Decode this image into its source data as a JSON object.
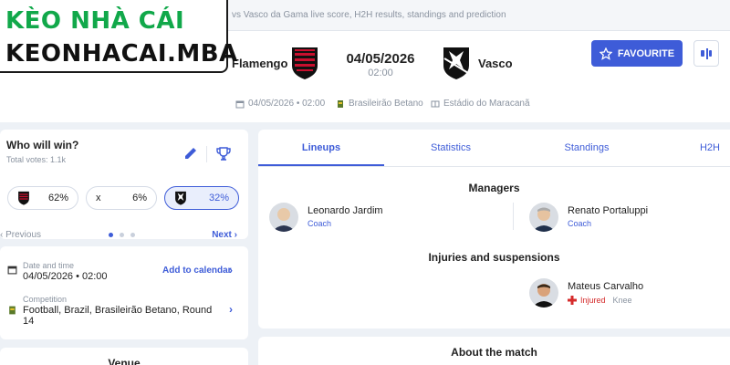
{
  "breadcrumb": "vs Vasco da Gama live score, H2H results, standings and prediction",
  "match": {
    "home_team": "Flamengo",
    "away_team": "Vasco",
    "date": "04/05/2026",
    "time": "02:00",
    "meta": {
      "datetime": "04/05/2026 • 02:00",
      "competition": "Brasileirão Betano",
      "stadium": "Estádio do Maracanã"
    }
  },
  "actions": {
    "favourite_label": "FAVOURITE",
    "favourite_icon": "star-icon",
    "more_icon": "options-icon"
  },
  "who_will_win": {
    "title": "Who will win?",
    "votes": "Total votes: 1.1k",
    "options": [
      {
        "label": "62%"
      },
      {
        "label": "x",
        "value": "6%"
      },
      {
        "label": "32%"
      }
    ],
    "prev_label": "Previous",
    "next_label": "Next"
  },
  "details": {
    "date_label": "Date and time",
    "date_value": "04/05/2026 • 02:00",
    "add_calendar": "Add to calendar",
    "competition_label": "Competition",
    "competition_value_line1": "Football, Brazil, Brasileirão Betano, Round",
    "competition_value_line2": "14"
  },
  "venue_title": "Venue",
  "tabs": [
    "Lineups",
    "Statistics",
    "Standings",
    "H2H"
  ],
  "lineups": {
    "managers_title": "Managers",
    "home_manager": {
      "name": "Leonardo Jardim",
      "role": "Coach"
    },
    "away_manager": {
      "name": "Renato Portaluppi",
      "role": "Coach"
    },
    "injuries_title": "Injuries and suspensions",
    "injured_player": {
      "name": "Mateus Carvalho",
      "status": "Injured",
      "injury": "Knee"
    }
  },
  "about_title": "About the match",
  "watermark": {
    "line1": "KÈO NHÀ CÁI",
    "line2": "KEONHACAI.MBA"
  },
  "colors": {
    "accent": "#3e5cd8",
    "flamengo_red": "#c8102e",
    "logo_green": "#11a84a"
  }
}
